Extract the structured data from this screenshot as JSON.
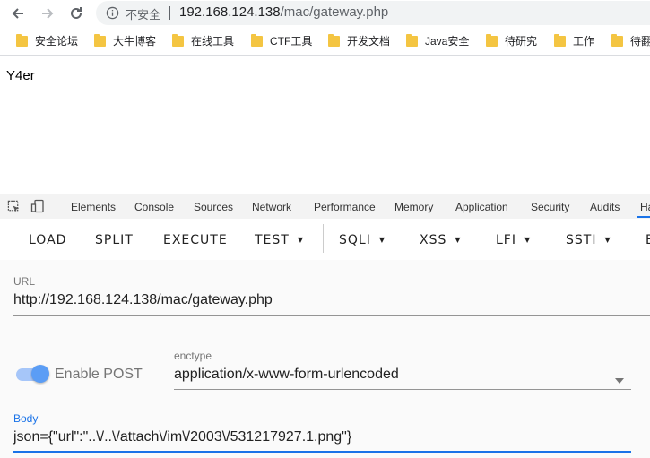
{
  "browser": {
    "security_label": "不安全",
    "url_host": "192.168.124.138",
    "url_path": "/mac/gateway.php"
  },
  "bookmarks": [
    "安全论坛",
    "大牛博客",
    "在线工具",
    "CTF工具",
    "开发文档",
    "Java安全",
    "待研究",
    "工作",
    "待翻"
  ],
  "page": {
    "text": "Y4er"
  },
  "devtools": {
    "tabs": [
      "Elements",
      "Console",
      "Sources",
      "Network",
      "Performance",
      "Memory",
      "Application",
      "Security",
      "Audits",
      "Ha"
    ]
  },
  "hackbar": {
    "buttons": {
      "load": "LOAD",
      "split": "SPLIT",
      "execute": "EXECUTE",
      "test": "TEST",
      "sqli": "SQLI",
      "xss": "XSS",
      "lfi": "LFI",
      "ssti": "SSTI",
      "more": "E"
    },
    "url_label": "URL",
    "url_value": "http://192.168.124.138/mac/gateway.php",
    "enable_post_label": "Enable POST",
    "enable_post": true,
    "enctype_label": "enctype",
    "enctype_value": "application/x-www-form-urlencoded",
    "body_label": "Body",
    "body_value": "json={\"url\":\"..\\/..\\/attach\\/im\\/2003\\/531217927.1.png\"}"
  },
  "colors": {
    "accent": "#1a73e8",
    "switch": "#5b9df5"
  }
}
